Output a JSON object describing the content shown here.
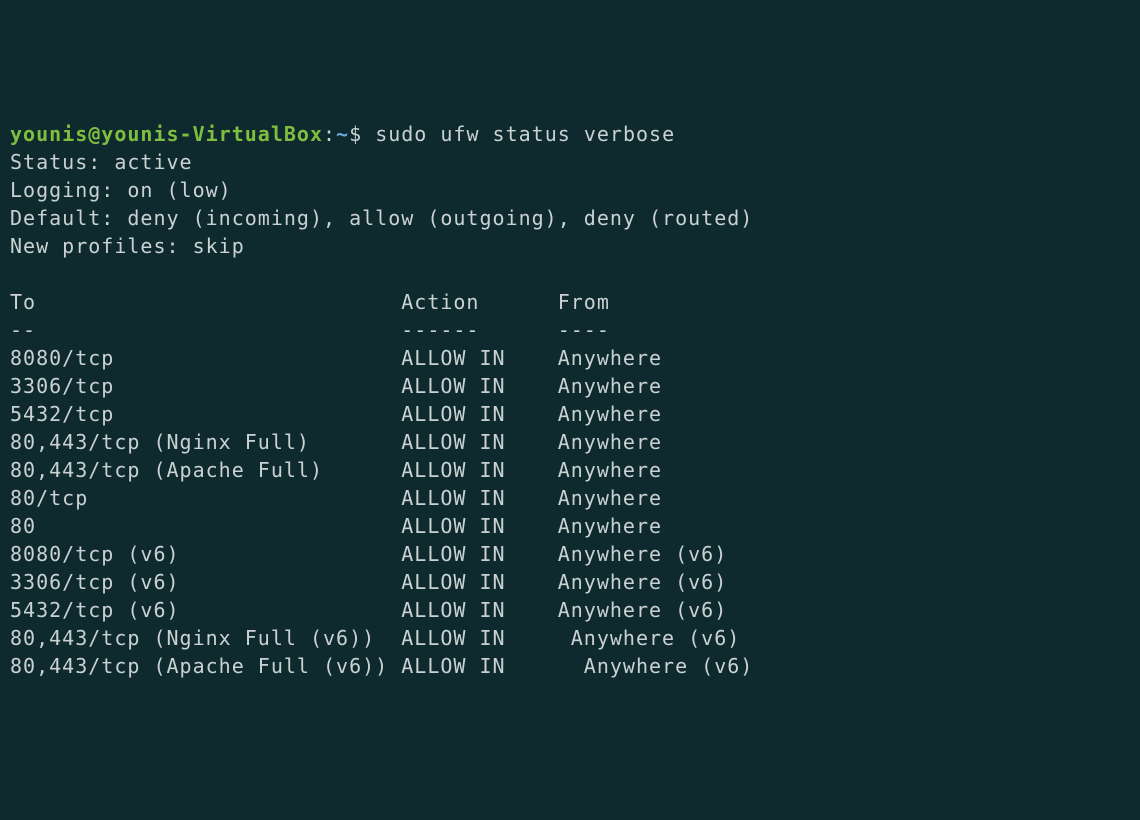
{
  "prompt": {
    "user": "younis",
    "at": "@",
    "host": "younis-VirtualBox",
    "colon": ":",
    "path": "~",
    "dollar": "$ ",
    "command": "sudo ufw status verbose"
  },
  "status_line": "Status: active",
  "logging_line": "Logging: on (low)",
  "default_line": "Default: deny (incoming), allow (outgoing), deny (routed)",
  "profiles_line": "New profiles: skip",
  "header": {
    "to": "To",
    "action": "Action",
    "from": "From"
  },
  "divider": {
    "to": "--",
    "action": "------",
    "from": "----"
  },
  "rules": [
    {
      "to": "8080/tcp",
      "action": "ALLOW IN",
      "from": "Anywhere"
    },
    {
      "to": "3306/tcp",
      "action": "ALLOW IN",
      "from": "Anywhere"
    },
    {
      "to": "5432/tcp",
      "action": "ALLOW IN",
      "from": "Anywhere"
    },
    {
      "to": "80,443/tcp (Nginx Full)",
      "action": "ALLOW IN",
      "from": "Anywhere"
    },
    {
      "to": "80,443/tcp (Apache Full)",
      "action": "ALLOW IN",
      "from": "Anywhere"
    },
    {
      "to": "80/tcp",
      "action": "ALLOW IN",
      "from": "Anywhere"
    },
    {
      "to": "80",
      "action": "ALLOW IN",
      "from": "Anywhere"
    },
    {
      "to": "8080/tcp (v6)",
      "action": "ALLOW IN",
      "from": "Anywhere (v6)"
    },
    {
      "to": "3306/tcp (v6)",
      "action": "ALLOW IN",
      "from": "Anywhere (v6)"
    },
    {
      "to": "5432/tcp (v6)",
      "action": "ALLOW IN",
      "from": "Anywhere (v6)"
    },
    {
      "to": "80,443/tcp (Nginx Full (v6))",
      "action": "ALLOW IN",
      "from": " Anywhere (v6)"
    },
    {
      "to": "80,443/tcp (Apache Full (v6))",
      "action": "ALLOW IN",
      "from": "  Anywhere (v6)"
    }
  ]
}
